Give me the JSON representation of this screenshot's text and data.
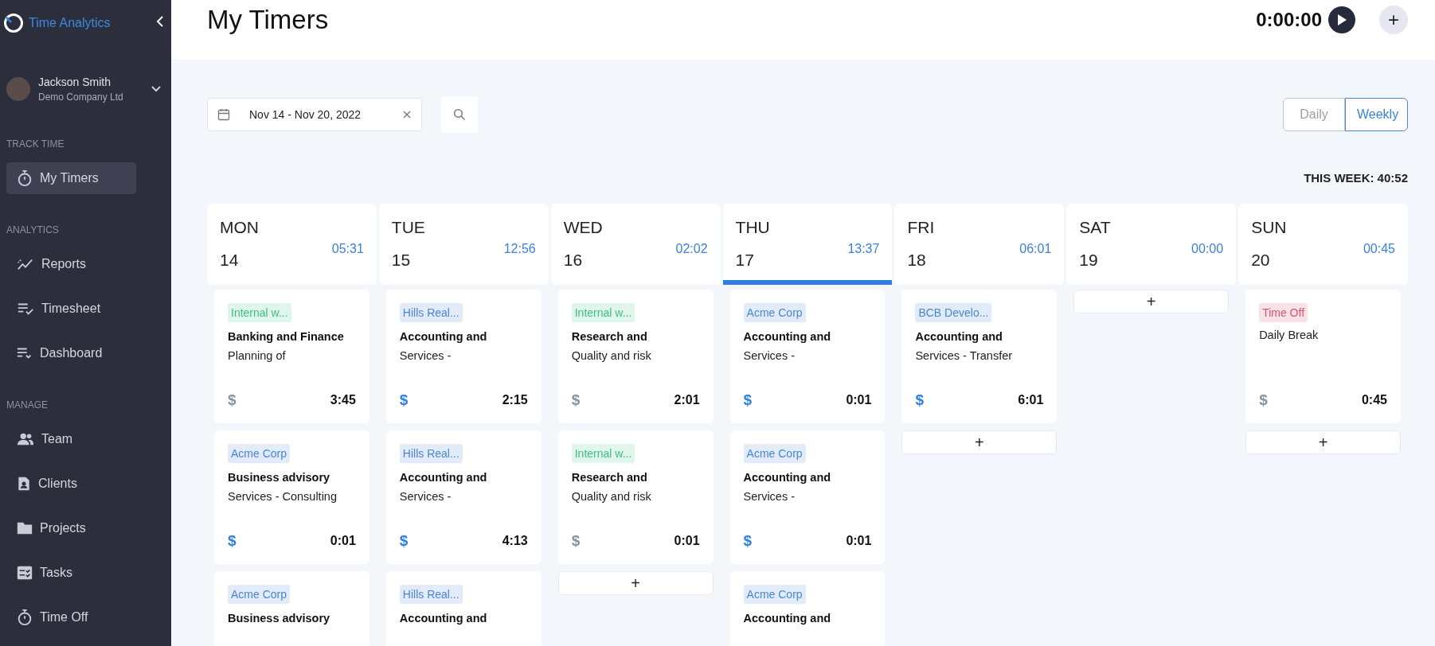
{
  "sidebar": {
    "brand": "Time Analytics",
    "user": {
      "name": "Jackson Smith",
      "company": "Demo Company Ltd"
    },
    "sections": [
      {
        "title": "TRACK TIME",
        "items": [
          {
            "label": "My Timers",
            "kind": "stopwatch",
            "selected": true
          }
        ]
      },
      {
        "title": "ANALYTICS",
        "items": [
          {
            "label": "Reports",
            "kind": "trend",
            "selected": false
          },
          {
            "label": "Timesheet",
            "kind": "listcheck",
            "selected": false
          },
          {
            "label": "Dashboard",
            "kind": "listdown",
            "selected": false
          }
        ]
      },
      {
        "title": "MANAGE",
        "items": [
          {
            "label": "Team",
            "kind": "people",
            "selected": false
          },
          {
            "label": "Clients",
            "kind": "contact",
            "selected": false
          },
          {
            "label": "Projects",
            "kind": "folder",
            "selected": false
          },
          {
            "label": "Tasks",
            "kind": "tasks",
            "selected": false
          },
          {
            "label": "Time Off",
            "kind": "stopwatch",
            "selected": false
          }
        ]
      }
    ]
  },
  "header": {
    "title": "My Timers",
    "timer": "0:00:00",
    "add_label": "+"
  },
  "toolbar": {
    "date_range": "Nov 14 - Nov 20, 2022",
    "views": [
      {
        "label": "Daily",
        "selected": false
      },
      {
        "label": "Weekly",
        "selected": true
      }
    ],
    "week_total": "THIS WEEK: 40:52"
  },
  "days": [
    {
      "name": "MON",
      "date": "14",
      "total": "05:31",
      "selected": false,
      "entries": [
        {
          "tag": "Internal w...",
          "color": "#3fbf7f",
          "title": "Banking and Finance",
          "description": "Planning of",
          "mark": "$",
          "billable": false,
          "time": "3:45"
        },
        {
          "tag": "Acme Corp",
          "color": "#4a86d4",
          "title": "Business advisory",
          "description": "Services - Consulting",
          "mark": "$",
          "billable": true,
          "time": "0:01"
        },
        {
          "tag": "Acme Corp",
          "color": "#4a86d4",
          "title": "Business advisory"
        }
      ]
    },
    {
      "name": "TUE",
      "date": "15",
      "total": "12:56",
      "selected": false,
      "entries": [
        {
          "tag": "Hills Real...",
          "color": "#4a86d4",
          "title": "Accounting and",
          "description": "Services -",
          "mark": "$",
          "billable": true,
          "time": "2:15"
        },
        {
          "tag": "Hills Real...",
          "color": "#4a86d4",
          "title": "Accounting and",
          "description": "Services -",
          "mark": "$",
          "billable": true,
          "time": "4:13"
        },
        {
          "tag": "Hills Real...",
          "color": "#4a86d4",
          "title": "Accounting and"
        }
      ]
    },
    {
      "name": "WED",
      "date": "16",
      "total": "02:02",
      "selected": false,
      "add_label": "+",
      "entries": [
        {
          "tag": "Internal w...",
          "color": "#3fbf7f",
          "title": "Research and",
          "description": "Quality and risk",
          "mark": "$",
          "billable": false,
          "time": "2:01"
        },
        {
          "tag": "Internal w...",
          "color": "#3fbf7f",
          "title": "Research and",
          "description": "Quality and risk",
          "mark": "$",
          "billable": false,
          "time": "0:01"
        }
      ]
    },
    {
      "name": "THU",
      "date": "17",
      "total": "13:37",
      "selected": true,
      "entries": [
        {
          "tag": "Acme Corp",
          "color": "#4a86d4",
          "title": "Accounting and",
          "description": "Services -",
          "mark": "$",
          "billable": true,
          "time": "0:01"
        },
        {
          "tag": "Acme Corp",
          "color": "#4a86d4",
          "title": "Accounting and",
          "description": "Services -",
          "mark": "$",
          "billable": true,
          "time": "0:01"
        },
        {
          "tag": "Acme Corp",
          "color": "#4a86d4",
          "title": "Accounting and"
        }
      ]
    },
    {
      "name": "FRI",
      "date": "18",
      "total": "06:01",
      "selected": false,
      "add_label": "+",
      "entries": [
        {
          "tag": "BCB Develo...",
          "color": "#4a86d4",
          "title": "Accounting and",
          "description": "Services - Transfer",
          "mark": "$",
          "billable": true,
          "time": "6:01"
        }
      ]
    },
    {
      "name": "SAT",
      "date": "19",
      "total": "00:00",
      "selected": false,
      "add_label": "+"
    },
    {
      "name": "SUN",
      "date": "20",
      "total": "00:45",
      "selected": false,
      "add_label": "+",
      "entries": [
        {
          "tag": "Time Off",
          "color": "#d9536f",
          "description": "Daily Break",
          "mark": "$",
          "billable": false,
          "time": "0:45"
        }
      ]
    }
  ]
}
